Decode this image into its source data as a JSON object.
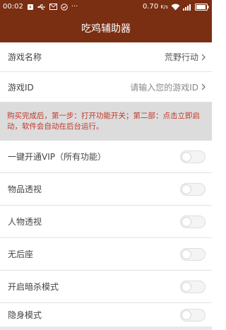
{
  "status_bar": {
    "time": "00:02",
    "more": "···",
    "speed": "0.70",
    "speed_unit": "K/s"
  },
  "header": {
    "title": "吃鸡辅助器"
  },
  "game_name": {
    "label": "游戏名称",
    "value": "荒野行动"
  },
  "game_id": {
    "label": "游戏ID",
    "placeholder": "请输入您的游戏ID"
  },
  "notice": "购买完成后，第一步：打开功能开关；第二部：点击立即启动，软件会自动在后台运行。",
  "features": [
    {
      "label": "一键开通VIP（所有功能）",
      "enabled": false
    },
    {
      "label": "物品透视",
      "enabled": false
    },
    {
      "label": "人物透视",
      "enabled": false
    },
    {
      "label": "无后座",
      "enabled": false
    },
    {
      "label": "开启暗杀模式",
      "enabled": false
    },
    {
      "label": "隐身模式",
      "enabled": false
    }
  ]
}
